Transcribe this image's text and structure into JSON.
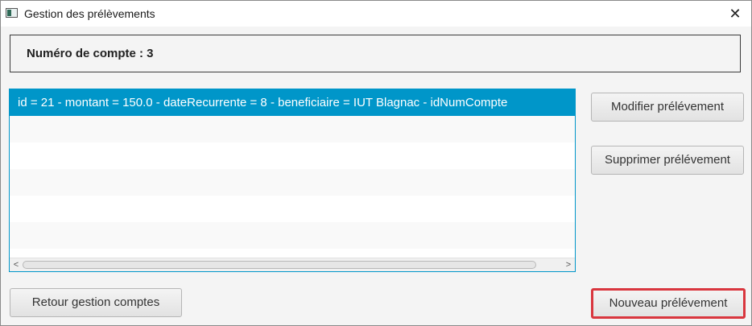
{
  "window": {
    "title": "Gestion des prélèvements",
    "close_glyph": "✕"
  },
  "account": {
    "label": "Numéro de compte : 3"
  },
  "list": {
    "rows": [
      "id = 21  -  montant = 150.0  -  dateRecurrente = 8  -  beneficiaire = IUT Blagnac  -  idNumCompte",
      "",
      "",
      "",
      "",
      ""
    ],
    "selected_index": 0,
    "scroll_left_glyph": "<",
    "scroll_right_glyph": ">"
  },
  "buttons": {
    "modify": "Modifier prélévement",
    "delete": "Supprimer prélévement",
    "back": "Retour gestion comptes",
    "new": "Nouveau prélévement"
  },
  "colors": {
    "selection": "#0096c9",
    "highlight_border": "#d9363e"
  },
  "icons": {
    "app": "app-window-icon",
    "close": "close-icon"
  }
}
